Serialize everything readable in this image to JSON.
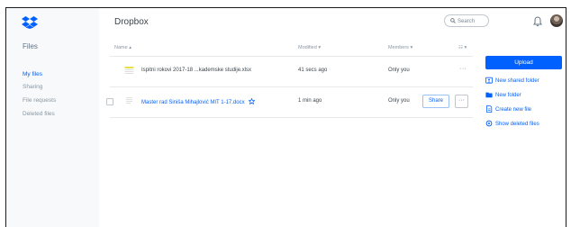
{
  "app": {
    "title": "Dropbox"
  },
  "sidebar": {
    "section": "Files",
    "items": [
      {
        "label": "My files",
        "active": true
      },
      {
        "label": "Sharing",
        "active": false
      },
      {
        "label": "File requests",
        "active": false
      },
      {
        "label": "Deleted files",
        "active": false
      }
    ]
  },
  "header": {
    "search_placeholder": "Search",
    "bell_icon": "bell-icon",
    "avatar": "user-avatar"
  },
  "table": {
    "columns": {
      "name": "Name ▴",
      "modified": "Modified ▾",
      "members": "Members ▾",
      "view": "☷ ▾"
    },
    "rows": [
      {
        "name": "Ispitni rokovi 2017-18 ...kademske studije.xlsx",
        "modified": "41 secs ago",
        "members": "Only you",
        "more": "···"
      },
      {
        "name": "Master rad Siniša Mihajlović MIT 1-17.docx",
        "modified": "1 min ago",
        "members": "Only you",
        "share": "Share",
        "more": "···"
      }
    ]
  },
  "actions": {
    "upload": "Upload",
    "items": [
      {
        "label": "New shared folder",
        "icon": "shared-folder-icon"
      },
      {
        "label": "New folder",
        "icon": "folder-icon"
      },
      {
        "label": "Create new file",
        "icon": "file-icon"
      },
      {
        "label": "Show deleted files",
        "icon": "deleted-files-icon"
      }
    ]
  },
  "colors": {
    "accent": "#0061fe",
    "sidebar_bg": "#f7f9fa"
  }
}
